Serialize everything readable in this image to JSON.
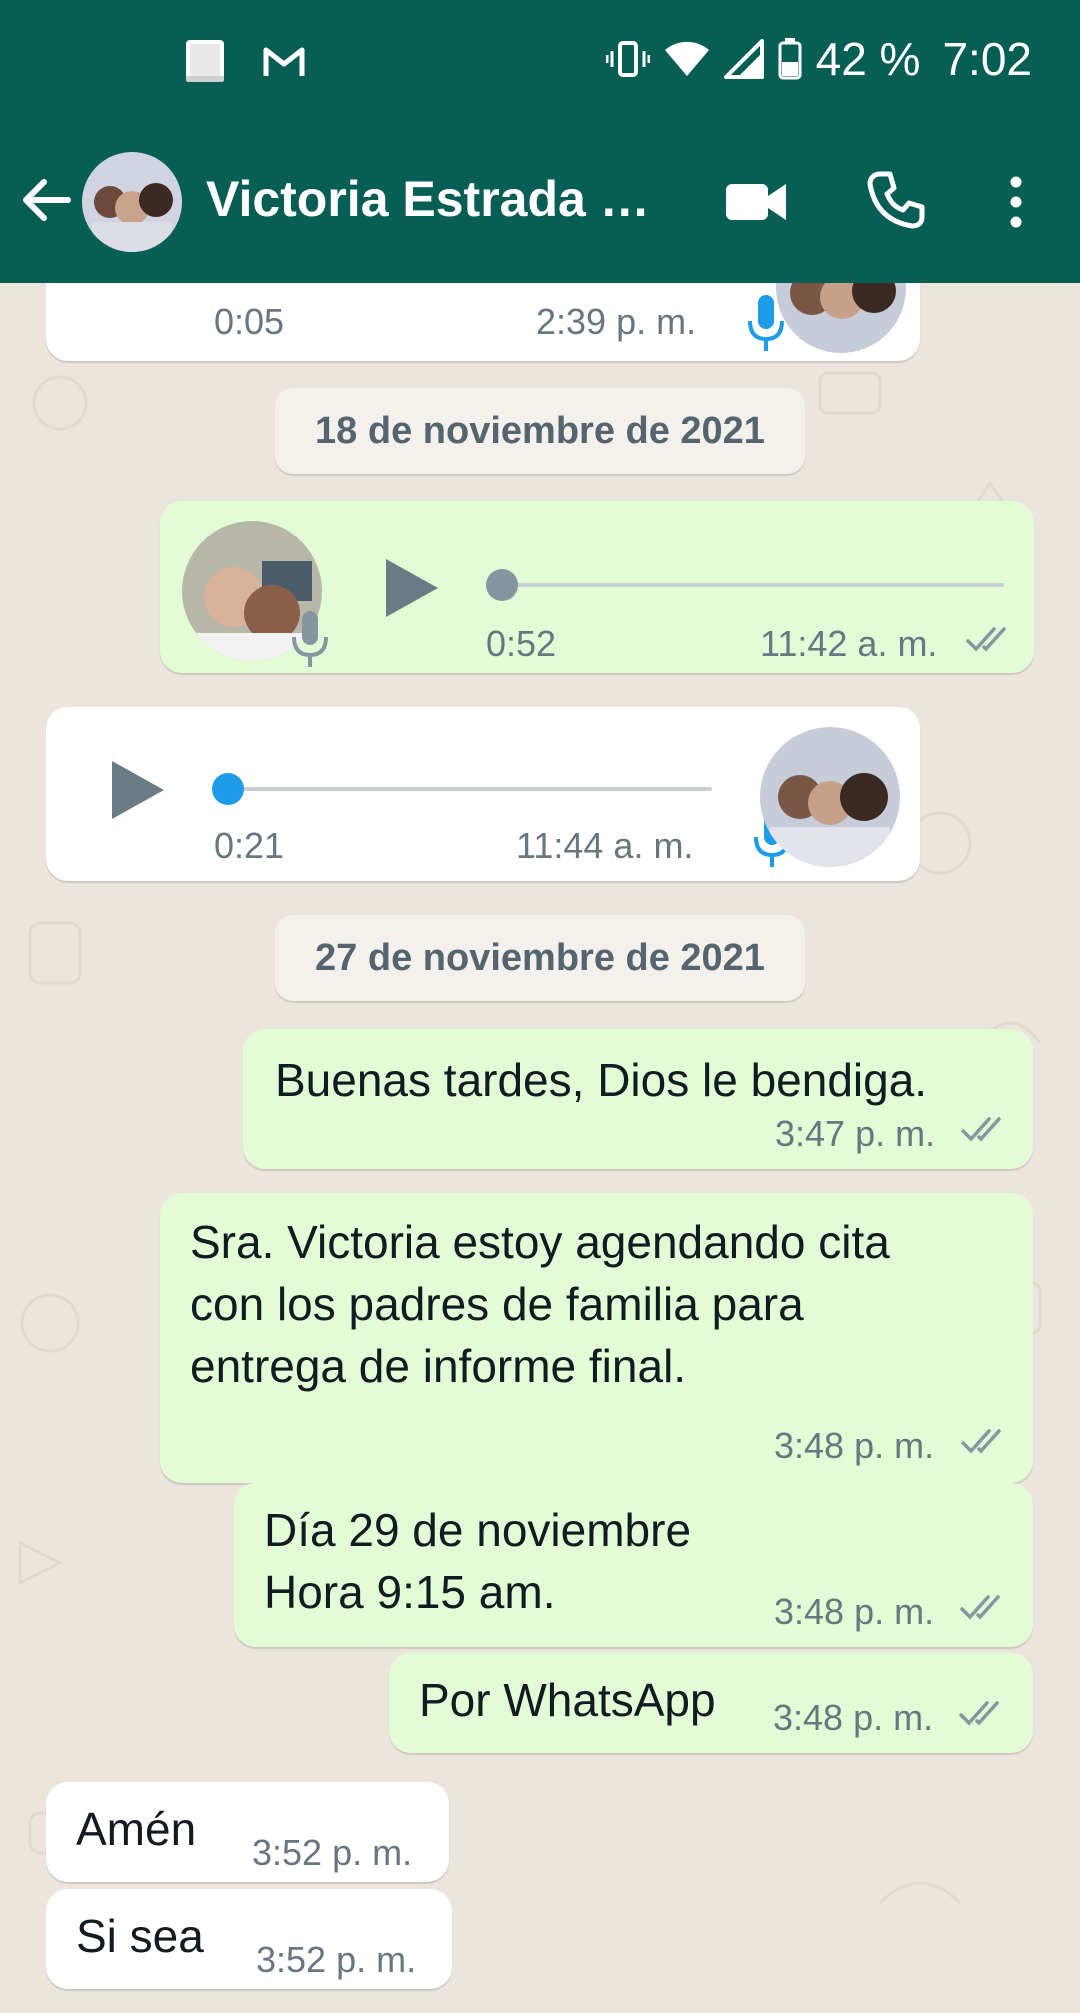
{
  "status_bar": {
    "battery_percent": "42 %",
    "time": "7:02",
    "icons": [
      "bible-app-icon",
      "gmail-icon",
      "vibrate-icon",
      "wifi-icon",
      "signal-icon",
      "battery-icon"
    ]
  },
  "header": {
    "contact_name": "Victoria Estrada M...",
    "icons": [
      "back-arrow-icon",
      "video-call-icon",
      "phone-icon",
      "more-options-icon"
    ]
  },
  "colors": {
    "header_bg": "#075e54",
    "outgoing_bubble": "#e2fcd5",
    "incoming_bubble": "#ffffff",
    "chat_bg": "#ece5dd",
    "accent_blue": "#1e9be9",
    "tick_grey": "#8696a0"
  },
  "messages": {
    "voice_top": {
      "duration": "0:05",
      "time": "2:39 p. m."
    },
    "date_1": "18 de noviembre de 2021",
    "voice_out": {
      "duration": "0:52",
      "time": "11:42 a. m.",
      "progress": 0
    },
    "voice_in": {
      "duration": "0:21",
      "time": "11:44 a. m.",
      "progress": 0
    },
    "date_2": "27 de noviembre de 2021",
    "m1": {
      "text": "Buenas tardes, Dios le bendiga.",
      "time": "3:47 p. m."
    },
    "m2": {
      "text": "Sra. Victoria estoy agendando cita\ncon los padres de familia para\nentrega de informe final.",
      "time": "3:48 p. m."
    },
    "m3": {
      "text": "Día 29 de noviembre\nHora 9:15 am.",
      "time": "3:48 p. m."
    },
    "m4": {
      "text": "Por WhatsApp",
      "time": "3:48 p. m."
    },
    "m5": {
      "text": "Amén",
      "time": "3:52 p. m."
    },
    "m6": {
      "text": "Si sea",
      "time": "3:52 p. m."
    }
  }
}
